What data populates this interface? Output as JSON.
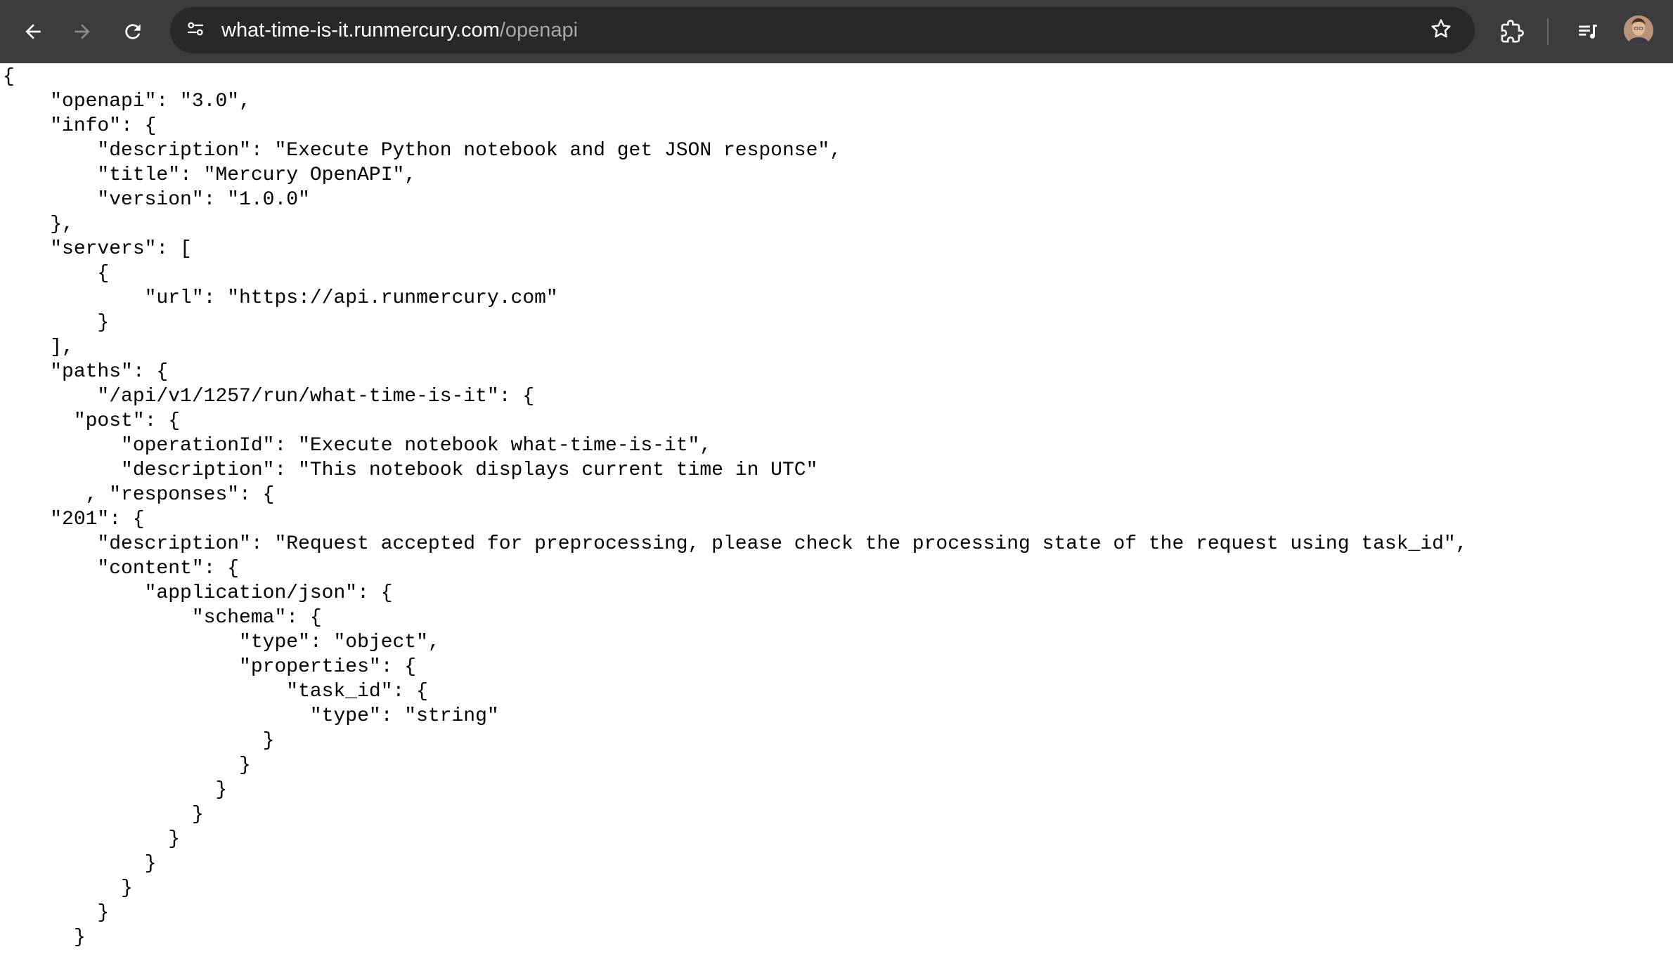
{
  "browser": {
    "url_host": "what-time-is-it.runmercury.com",
    "url_path": "/openapi",
    "icons": {
      "back": "arrow-left-icon",
      "forward": "arrow-right-icon",
      "reload": "reload-icon",
      "site_info": "tune-icon",
      "bookmark": "star-icon",
      "extensions": "puzzle-icon",
      "media": "playlist-music-icon",
      "profile": "avatar"
    }
  },
  "page": {
    "json_text": "{\n    \"openapi\": \"3.0\",\n    \"info\": {\n        \"description\": \"Execute Python notebook and get JSON response\",\n        \"title\": \"Mercury OpenAPI\",\n        \"version\": \"1.0.0\"\n    },\n    \"servers\": [\n        {\n            \"url\": \"https://api.runmercury.com\"\n        }\n    ],\n    \"paths\": {\n        \"/api/v1/1257/run/what-time-is-it\": {\n      \"post\": {\n          \"operationId\": \"Execute notebook what-time-is-it\",\n          \"description\": \"This notebook displays current time in UTC\"\n       , \"responses\": {\n    \"201\": {\n        \"description\": \"Request accepted for preprocessing, please check the processing state of the request using task_id\",\n        \"content\": {\n            \"application/json\": {\n                \"schema\": {\n                    \"type\": \"object\",\n                    \"properties\": {\n                        \"task_id\": {\n                          \"type\": \"string\"\n                      }\n                    }\n                  }\n                }\n              }\n            }\n          }\n        }\n      }"
  }
}
